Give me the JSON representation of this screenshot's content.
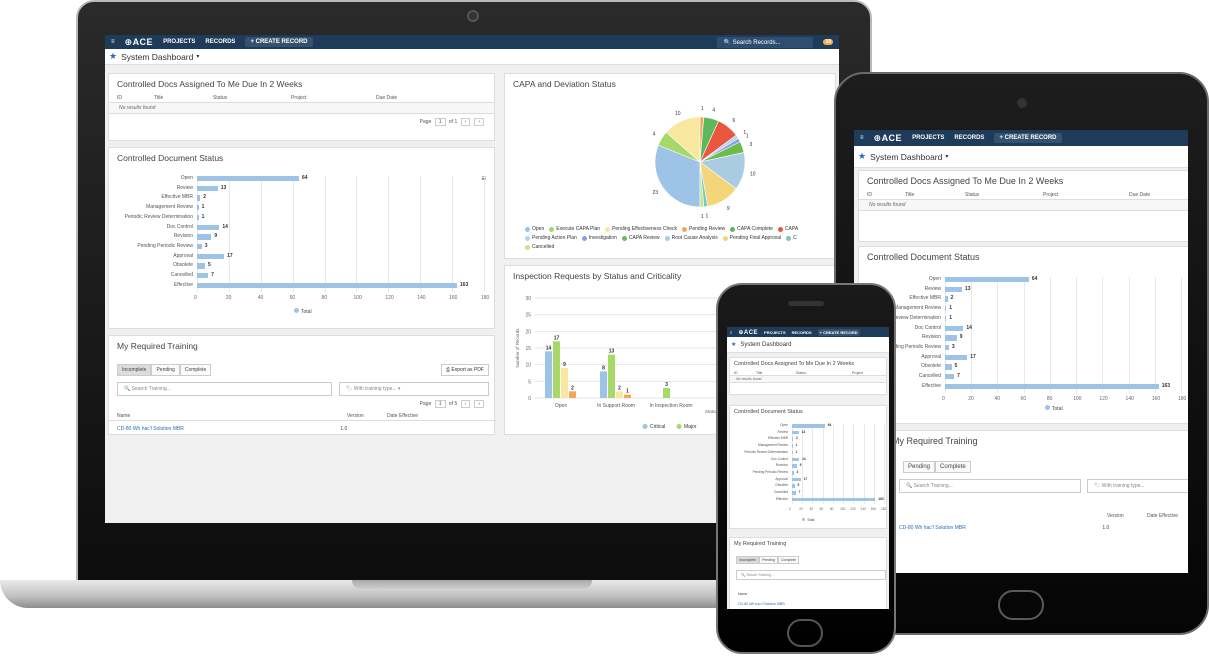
{
  "app": {
    "logo": "ACE",
    "nav": [
      "PROJECTS",
      "RECORDS"
    ],
    "create_label": "+ CREATE RECORD",
    "search_placeholder": "Search Records...",
    "notification_count": "10",
    "page_title": "System Dashboard"
  },
  "controlled_docs": {
    "title": "Controlled Docs Assigned To Me Due In 2 Weeks",
    "columns": [
      "ID",
      "Title",
      "Status",
      "Project",
      "Due Date"
    ],
    "empty": "No results found",
    "pager": {
      "prefix": "Page",
      "page": "1",
      "of": "of 1"
    }
  },
  "doc_status": {
    "title": "Controlled Document Status",
    "legend": "Total",
    "chart_data": {
      "type": "bar",
      "orientation": "horizontal",
      "categories": [
        "Open",
        "Review",
        "Effective MBR",
        "Management Review",
        "Periodic Review Determination",
        "Doc Control",
        "Revision",
        "Pending Periodic Review",
        "Approval",
        "Obsolete",
        "Cancelled",
        "Effective"
      ],
      "series": [
        {
          "name": "Total",
          "values": [
            64,
            13,
            2,
            1,
            1,
            14,
            9,
            3,
            17,
            5,
            7,
            163
          ]
        }
      ],
      "xlim": [
        0,
        180
      ],
      "xticks": [
        "0",
        "20",
        "40",
        "60",
        "80",
        "100",
        "120",
        "140",
        "160",
        "180"
      ]
    }
  },
  "capa": {
    "title": "CAPA and Deviation Status",
    "chart_data": {
      "type": "pie",
      "categories": [
        "Open",
        "Execute CAPA Plan",
        "Pending Effectiveness Check",
        "Pending Review",
        "CAPA Complete",
        "CAPA Rejected",
        "Pending Action Plan",
        "Investigation",
        "CAPA Review",
        "Root Cause Analysis",
        "Pending Final Approval",
        "Closed",
        "Cancelled"
      ],
      "values": [
        23,
        4,
        10,
        1,
        4,
        6,
        1,
        1,
        3,
        10,
        9,
        1,
        1
      ],
      "colors": [
        "#9dc3e6",
        "#a6d96a",
        "#f9e79f",
        "#f5a55a",
        "#5cb85c",
        "#e9573f",
        "#aed6f1",
        "#8e9be8",
        "#6dbb4b",
        "#a9cce3",
        "#f3d67a",
        "#76c7c0",
        "#c6e48b"
      ]
    },
    "legend": [
      "Open",
      "Execute CAPA Plan",
      "Pending Effectiveness Check",
      "Pending Review",
      "CAPA Complete",
      "CAPA",
      "Pending Action Plan",
      "Investigation",
      "CAPA Review",
      "Root Cause Analysis",
      "Pending Final Approval",
      "C",
      "Cancelled"
    ],
    "labels": [
      "4",
      "10",
      "1",
      "4",
      "6",
      "1",
      "1",
      "3",
      "10",
      "9",
      "1",
      "1",
      "23"
    ]
  },
  "training": {
    "title": "My Required Training",
    "tabs": [
      "Incomplete",
      "Pending",
      "Complete"
    ],
    "export_label": "Export as PDF",
    "search_placeholder": "Search Training...",
    "type_placeholder": "With training type...",
    "pager": {
      "prefix": "Page",
      "page": "1",
      "of": "of 5"
    },
    "columns": [
      "Name",
      "Version",
      "Date Effective"
    ],
    "row": {
      "name": "CD-80 Wh hac'l Solution MBR",
      "version": "1.0"
    }
  },
  "inspection": {
    "title": "Inspection Requests by Status and Criticality",
    "ylabel": "Number of Records",
    "xlabel": "Status of Re",
    "chart_data": {
      "type": "bar",
      "categories": [
        "Open",
        "In Support Room",
        "In Inspection Room"
      ],
      "series": [
        {
          "name": "Critical",
          "values": [
            14,
            8,
            0
          ]
        },
        {
          "name": "Major",
          "values": [
            17,
            13,
            3
          ]
        },
        {
          "name": "",
          "values": [
            9,
            2,
            0
          ]
        },
        {
          "name": "",
          "values": [
            2,
            1,
            0
          ]
        }
      ],
      "ylim": [
        0,
        30
      ],
      "yticks": [
        "0",
        "5",
        "10",
        "15",
        "20",
        "25",
        "30"
      ],
      "colors": [
        "#9dc3e6",
        "#a6d96a",
        "#f9e79f",
        "#f5a55a"
      ]
    },
    "legend": [
      "Critical",
      "Major"
    ]
  }
}
